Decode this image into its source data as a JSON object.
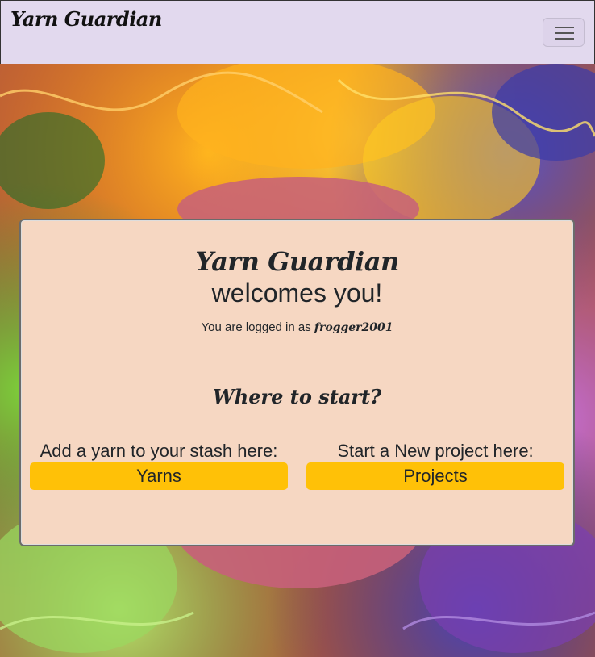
{
  "navbar": {
    "brand": "Yarn Guardian",
    "menu_icon": "hamburger-menu-icon"
  },
  "hero": {
    "background": "colorful-embroidery-thread-image",
    "colors": [
      "#f28a16",
      "#ffc21a",
      "#e23b1c",
      "#2f9c3b",
      "#a8d83a",
      "#3d3a9c",
      "#9a4fc0",
      "#c8609a"
    ]
  },
  "card": {
    "title_script": "Yarn Guardian",
    "title_welcome": "welcomes you!",
    "logged_in_prefix": "You are logged in as",
    "username": "frogger2001",
    "where_heading": "Where to start?",
    "yarn_prompt": "Add a yarn to your stash here:",
    "yarn_button": "Yarns",
    "project_prompt": "Start a New project here:",
    "project_button": "Projects",
    "background_color": "#f6d7c2",
    "button_color": "#ffc107"
  }
}
